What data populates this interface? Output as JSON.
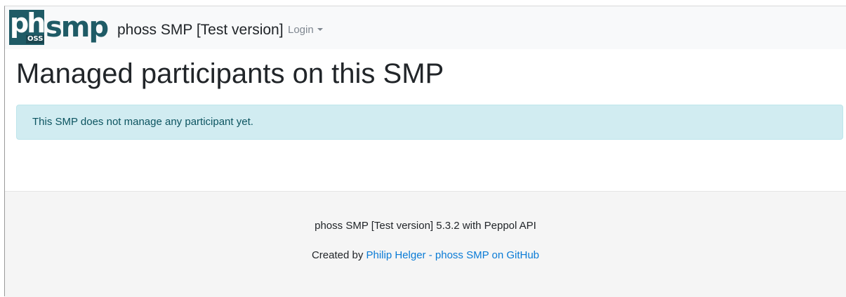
{
  "navbar": {
    "logo": {
      "letters": "ph",
      "suffix": "smp",
      "badge": "OSS"
    },
    "brand": "phoss SMP [Test version]",
    "login_label": "Login"
  },
  "main": {
    "title": "Managed participants on this SMP",
    "alert": "This SMP does not manage any participant yet."
  },
  "footer": {
    "version_line": "phoss SMP [Test version] 5.3.2 with Peppol API",
    "created_by": "Created by",
    "author_link": "Philip Helger",
    "separator": "-",
    "github_link": "phoss SMP on GitHub"
  },
  "colors": {
    "navbar_bg": "#f8f9fa",
    "logo": "#1f5b66",
    "alert_bg": "#d1ecf1",
    "alert_text": "#0c5460",
    "link": "#0a7bd6",
    "footer_bg": "#f5f5f5"
  }
}
